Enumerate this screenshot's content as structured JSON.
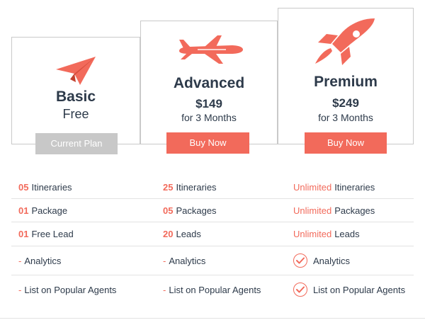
{
  "colors": {
    "accent": "#f26a5b",
    "text": "#2d3a4a",
    "disabled": "#c8c8c8",
    "border": "#c9c9c9"
  },
  "plans": {
    "basic": {
      "icon": "paper-plane-icon",
      "title": "Basic",
      "subtitle": "Free",
      "button": "Current Plan"
    },
    "advanced": {
      "icon": "airplane-icon",
      "title": "Advanced",
      "price": "$149",
      "period": "for 3 Months",
      "button": "Buy Now"
    },
    "premium": {
      "icon": "rocket-icon",
      "title": "Premium",
      "price": "$249",
      "period": "for 3 Months",
      "button": "Buy Now"
    }
  },
  "features": {
    "rows": [
      {
        "basic": {
          "value": "05",
          "label": "Itineraries"
        },
        "advanced": {
          "value": "25",
          "label": "Itineraries"
        },
        "premium": {
          "value": "Unlimited",
          "label": "Itineraries"
        }
      },
      {
        "basic": {
          "value": "01",
          "label": "Package"
        },
        "advanced": {
          "value": "05",
          "label": "Packages"
        },
        "premium": {
          "value": "Unlimited",
          "label": "Packages"
        }
      },
      {
        "basic": {
          "value": "01",
          "label": "Free Lead"
        },
        "advanced": {
          "value": "20",
          "label": "Leads"
        },
        "premium": {
          "value": "Unlimited",
          "label": "Leads"
        }
      },
      {
        "basic": {
          "mark": "-",
          "label": "Analytics"
        },
        "advanced": {
          "mark": "-",
          "label": "Analytics"
        },
        "premium": {
          "icon": "check-circle-icon",
          "label": "Analytics"
        }
      },
      {
        "basic": {
          "mark": "-",
          "label": "List on Popular Agents"
        },
        "advanced": {
          "mark": "-",
          "label": "List on Popular Agents"
        },
        "premium": {
          "icon": "check-circle-icon",
          "label": "List on Popular Agents"
        }
      }
    ]
  }
}
